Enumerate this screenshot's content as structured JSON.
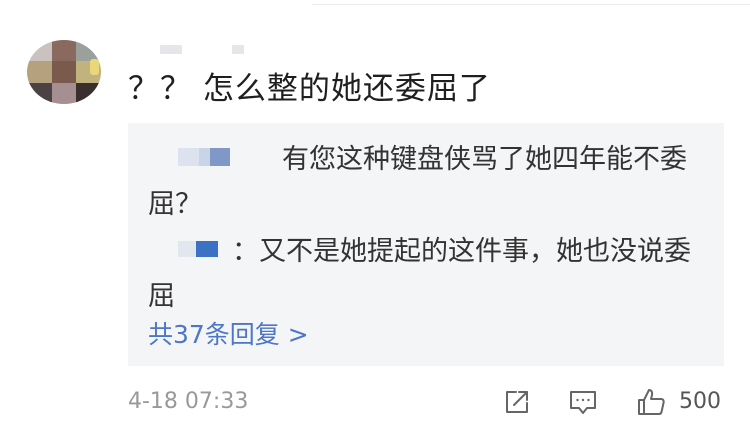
{
  "comment": {
    "text": "？？ 怎么整的她还委屈了"
  },
  "replies": [
    {
      "text": "有您这种键盘侠骂了她四年能不委屈？"
    },
    {
      "text": "：又不是她提起的这件事，她也没说委屈"
    }
  ],
  "more_replies": {
    "label": "共37条回复 >"
  },
  "footer": {
    "timestamp": "4-18 07:33",
    "like_count": "500"
  },
  "icons": {
    "share": "share-icon",
    "comment": "comment-icon",
    "like": "thumbs-up-icon"
  },
  "colors": {
    "link": "#4e76c7",
    "reply_background": "#f4f5f7",
    "meta_text": "#999999"
  }
}
